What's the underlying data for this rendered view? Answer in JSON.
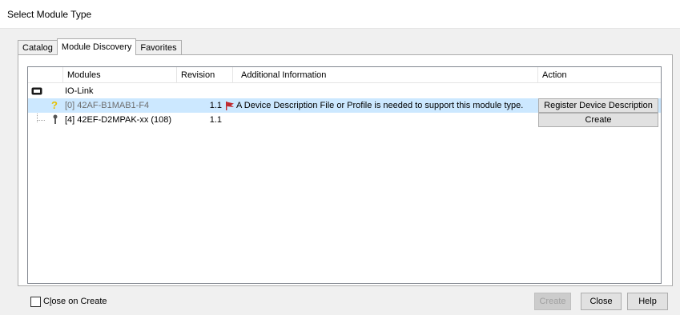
{
  "window": {
    "title": "Select Module Type"
  },
  "tabs": [
    {
      "label": "Catalog",
      "active": false
    },
    {
      "label": "Module Discovery",
      "active": true
    },
    {
      "label": "Favorites",
      "active": false
    }
  ],
  "grid": {
    "columns": {
      "modules": "Modules",
      "revision": "Revision",
      "info": "Additional Information",
      "action": "Action"
    },
    "rows": [
      {
        "module": "IO-Link",
        "revision": "",
        "info": "",
        "action": ""
      },
      {
        "module": "[0] 42AF-B1MAB1-F4",
        "revision": "1.1",
        "info": "A Device Description File or Profile is needed to support this module type.",
        "action": "Register Device Description",
        "selected": true
      },
      {
        "module": "[4] 42EF-D2MPAK-xx (108)",
        "revision": "1.1",
        "info": "",
        "action": "Create"
      }
    ]
  },
  "footer": {
    "close_on_create_pre": "C",
    "close_on_create_accel": "l",
    "close_on_create_post": "ose on Create",
    "close_on_create_checked": false,
    "create_label": "Create",
    "close_label": "Close",
    "help_label": "Help"
  },
  "colors": {
    "selected_row": "#cce8ff",
    "flag": "#c0282e",
    "warning_icon": "#e6c000"
  }
}
